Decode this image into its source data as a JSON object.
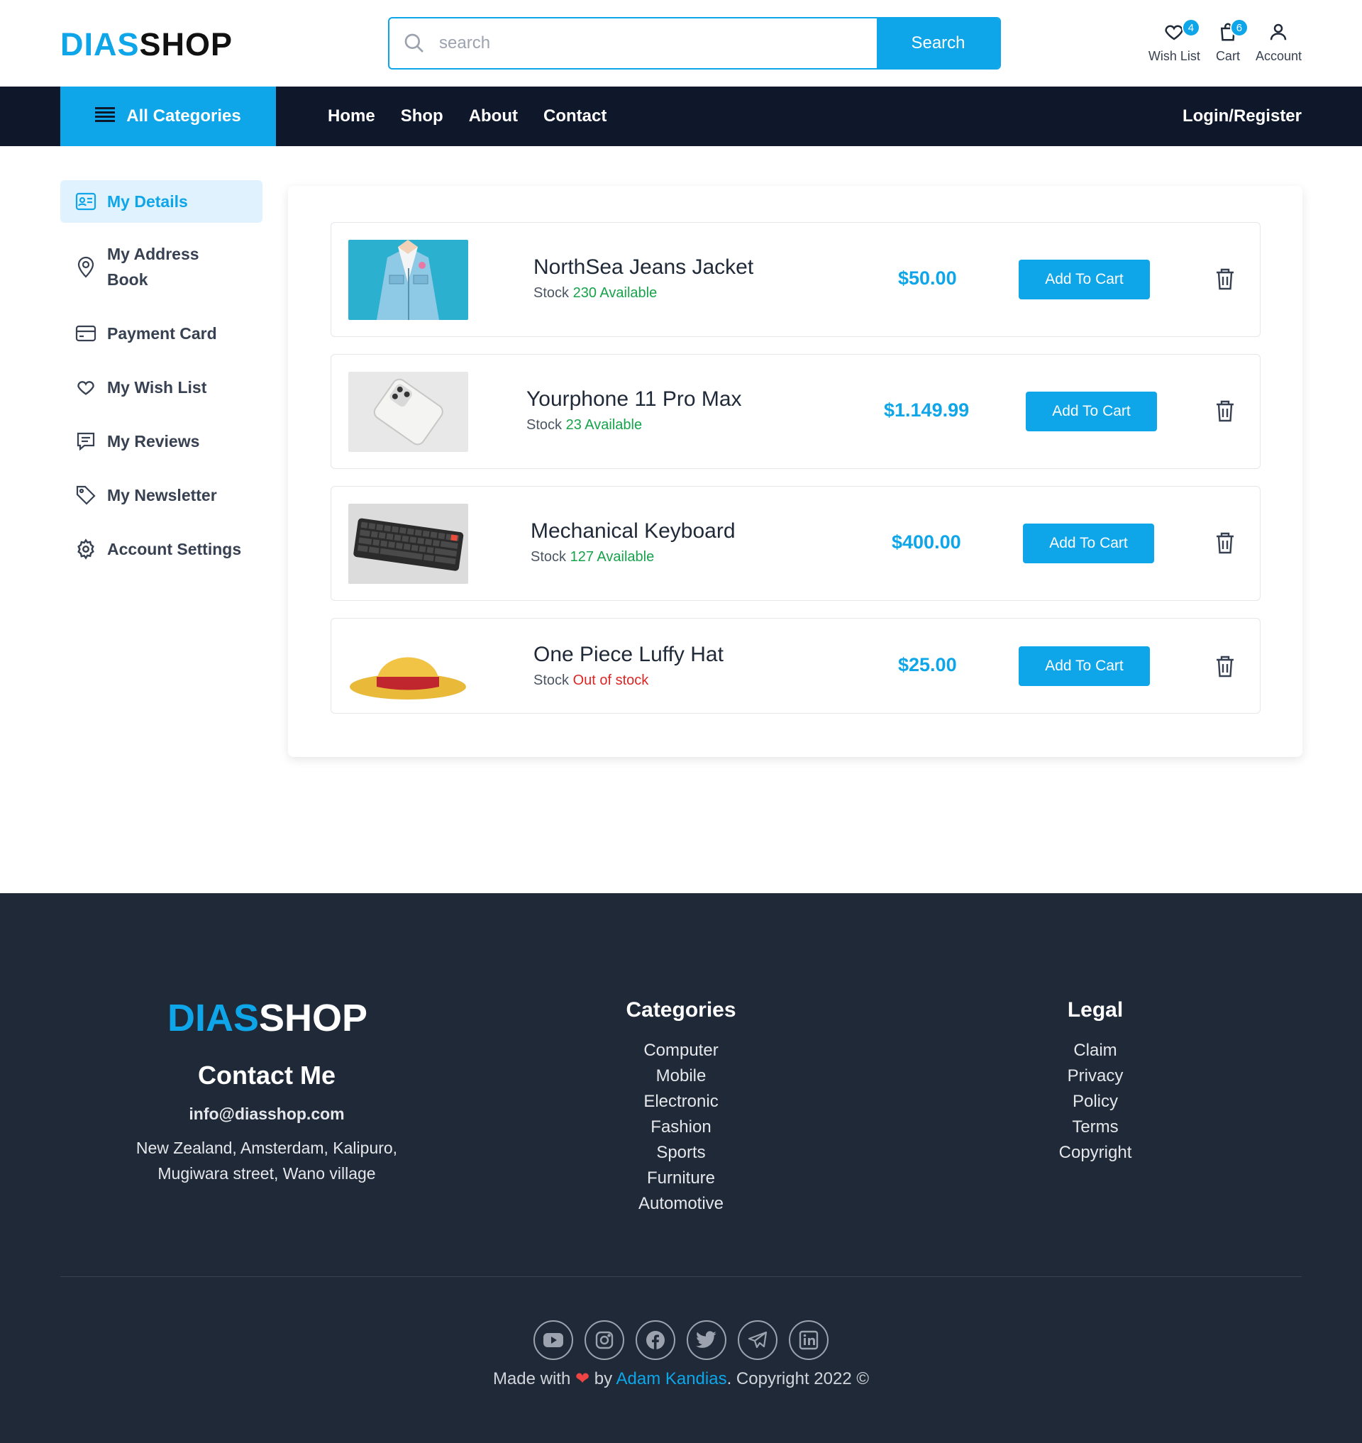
{
  "brand": {
    "part1": "DIAS",
    "part2": "SHOP"
  },
  "search": {
    "placeholder": "search",
    "button": "Search"
  },
  "header_icons": {
    "wishlist": {
      "label": "Wish List",
      "count": "4"
    },
    "cart": {
      "label": "Cart",
      "count": "6"
    },
    "account": {
      "label": "Account"
    }
  },
  "nav": {
    "all_categories": "All Categories",
    "links": [
      "Home",
      "Shop",
      "About",
      "Contact"
    ],
    "login": "Login/Register"
  },
  "sidebar": {
    "items": [
      {
        "label": "My Details",
        "icon": "id-card-icon",
        "active": true
      },
      {
        "label": "My Address Book",
        "icon": "map-pin-icon"
      },
      {
        "label": "Payment Card",
        "icon": "credit-card-icon"
      },
      {
        "label": "My Wish List",
        "icon": "heart-icon"
      },
      {
        "label": "My Reviews",
        "icon": "message-icon"
      },
      {
        "label": "My Newsletter",
        "icon": "tag-icon"
      },
      {
        "label": "Account Settings",
        "icon": "gear-icon"
      }
    ]
  },
  "wishlist": {
    "stock_label": "Stock",
    "add_label": "Add To Cart",
    "items": [
      {
        "name": "NorthSea Jeans Jacket",
        "stock": "230 Available",
        "in_stock": true,
        "price": "$50.00",
        "image": "denim-jacket-image"
      },
      {
        "name": "Yourphone 11 Pro Max",
        "stock": "23 Available",
        "in_stock": true,
        "price": "$1.149.99",
        "image": "phone-image"
      },
      {
        "name": "Mechanical Keyboard",
        "stock": "127 Available",
        "in_stock": true,
        "price": "$400.00",
        "image": "keyboard-image"
      },
      {
        "name": "One Piece Luffy Hat",
        "stock": "Out of stock",
        "in_stock": false,
        "price": "$25.00",
        "image": "straw-hat-image"
      }
    ]
  },
  "footer": {
    "brand": {
      "part1": "DIAS",
      "part2": "SHOP"
    },
    "contact_title": "Contact Me",
    "email": "info@diasshop.com",
    "address_line1": "New Zealand, Amsterdam, Kalipuro,",
    "address_line2": "Mugiwara street, Wano village",
    "categories_title": "Categories",
    "categories": [
      "Computer",
      "Mobile",
      "Electronic",
      "Fashion",
      "Sports",
      "Furniture",
      "Automotive"
    ],
    "legal_title": "Legal",
    "legal": [
      "Claim",
      "Privacy",
      "Policy",
      "Terms",
      "Copyright"
    ],
    "socials": [
      "youtube-icon",
      "instagram-icon",
      "facebook-icon",
      "twitter-icon",
      "telegram-icon",
      "linkedin-icon"
    ],
    "made_with": "Made with",
    "by": "by",
    "author": "Adam Kandias",
    "copyright": ". Copyright 2022 ©"
  },
  "colors": {
    "accent": "#0ea5e9",
    "nav_bg": "#0f172a",
    "footer_bg": "#1f2937",
    "in_stock": "#16a34a",
    "out_of_stock": "#dc2626"
  }
}
